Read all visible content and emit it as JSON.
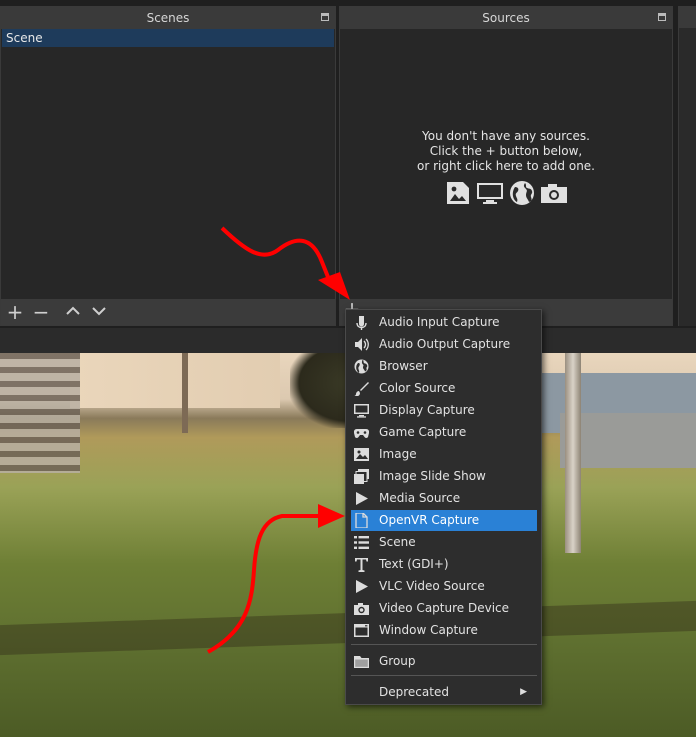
{
  "scenes": {
    "title": "Scenes",
    "items": [
      "Scene"
    ]
  },
  "sources": {
    "title": "Sources",
    "empty_line1": "You don't have any sources.",
    "empty_line2": "Click the + button below,",
    "empty_line3": "or right click here to add one.",
    "empty_icons": [
      "image-icon",
      "display-icon",
      "globe-icon",
      "camera-icon"
    ]
  },
  "menu": {
    "items": [
      {
        "label": "Audio Input Capture",
        "icon": "microphone-icon"
      },
      {
        "label": "Audio Output Capture",
        "icon": "speaker-icon"
      },
      {
        "label": "Browser",
        "icon": "globe-icon"
      },
      {
        "label": "Color Source",
        "icon": "brush-icon"
      },
      {
        "label": "Display Capture",
        "icon": "display-icon"
      },
      {
        "label": "Game Capture",
        "icon": "gamepad-icon"
      },
      {
        "label": "Image",
        "icon": "image-icon"
      },
      {
        "label": "Image Slide Show",
        "icon": "slideshow-icon"
      },
      {
        "label": "Media Source",
        "icon": "play-icon"
      },
      {
        "label": "OpenVR Capture",
        "icon": "file-icon",
        "selected": true
      },
      {
        "label": "Scene",
        "icon": "list-icon"
      },
      {
        "label": "Text (GDI+)",
        "icon": "text-icon"
      },
      {
        "label": "VLC Video Source",
        "icon": "play-icon"
      },
      {
        "label": "Video Capture Device",
        "icon": "camera-icon"
      },
      {
        "label": "Window Capture",
        "icon": "window-icon"
      }
    ],
    "group": {
      "label": "Group",
      "icon": "folder-icon"
    },
    "deprecated": {
      "label": "Deprecated"
    }
  },
  "colors": {
    "selection": "#2a81d6",
    "arrow": "#ff0000",
    "scene_selected": "#1e3b5b"
  }
}
